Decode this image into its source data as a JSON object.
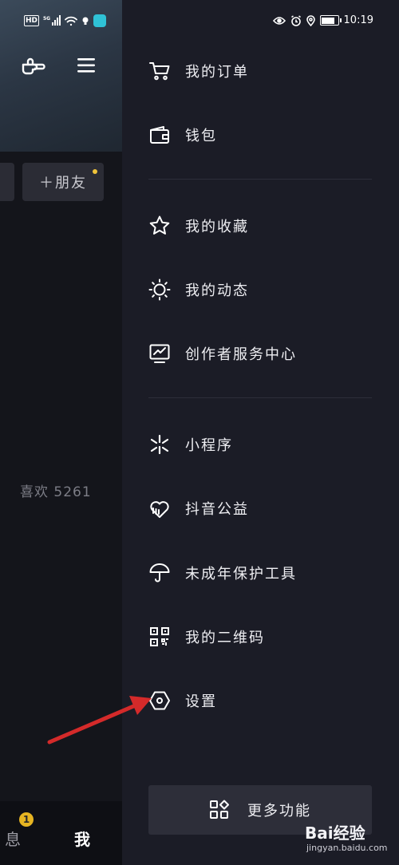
{
  "status_bar": {
    "network_label": "HD",
    "signal_label": "5G",
    "time": "10:19"
  },
  "background_profile": {
    "add_friend_label": "＋朋友",
    "likes_text": "喜欢 5261",
    "tab_message_label": "息",
    "tab_message_badge": "1",
    "tab_me_label": "我"
  },
  "drawer": {
    "items": [
      {
        "label": "我的订单",
        "icon": "cart-icon"
      },
      {
        "label": "钱包",
        "icon": "wallet-icon"
      },
      {
        "label": "我的收藏",
        "icon": "star-icon"
      },
      {
        "label": "我的动态",
        "icon": "sun-icon"
      },
      {
        "label": "创作者服务中心",
        "icon": "chart-monitor-icon"
      },
      {
        "label": "小程序",
        "icon": "asterisk-icon"
      },
      {
        "label": "抖音公益",
        "icon": "heart-hand-icon"
      },
      {
        "label": "未成年保护工具",
        "icon": "umbrella-icon"
      },
      {
        "label": "我的二维码",
        "icon": "qr-code-icon"
      },
      {
        "label": "设置",
        "icon": "settings-hex-icon"
      }
    ],
    "more_label": "更多功能"
  },
  "watermark": {
    "logo": "Bai经验",
    "url": "jingyan.baidu.com"
  },
  "colors": {
    "drawer_bg": "#1b1c26",
    "annotation_arrow": "#d42a2a",
    "badge": "#e6b422"
  }
}
